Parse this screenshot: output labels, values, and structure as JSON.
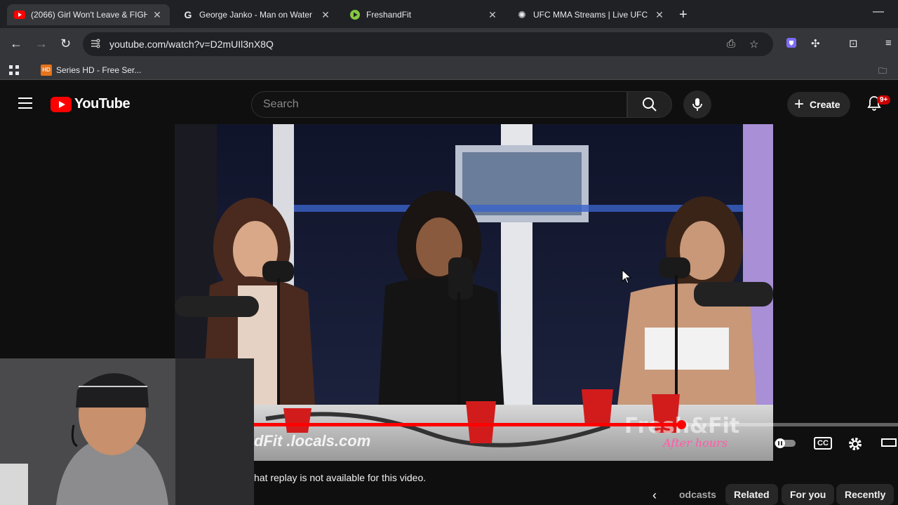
{
  "browser": {
    "tabs": [
      {
        "title": "(2066) Girl Won't Leave & FIGH",
        "icon": "youtube-icon",
        "active": true
      },
      {
        "title": "George Janko - Man on Water",
        "icon": "g-site-icon",
        "active": false
      },
      {
        "title": "FreshandFit",
        "icon": "rumble-icon",
        "active": false
      },
      {
        "title": "UFC MMA Streams | Live UFC C",
        "icon": "settings-site-icon",
        "active": false
      }
    ],
    "close_glyph": "✕",
    "new_tab_glyph": "+",
    "minimize_glyph": "—",
    "url": "youtube.com/watch?v=D2mUIl3nX8Q",
    "bookmarks": [
      {
        "label": "Series HD - Free Ser...",
        "icon": "series-hd-icon"
      }
    ],
    "bookmark_badge": "HD"
  },
  "youtube": {
    "logo_text": "YouTube",
    "search_placeholder": "Search",
    "create_label": "Create",
    "create_plus": "+",
    "notification_badge": "9+"
  },
  "video": {
    "watermark_text": "dFit .locals.com",
    "brand_overlay": "Fresh&Fit",
    "brand_overlay_sub": "After hours",
    "progress_fraction": 0.663,
    "cc_label": "CC"
  },
  "below_video": {
    "chat_message": "hat replay is not available for this video.",
    "chips": [
      "odcasts",
      "Related",
      "For you",
      "Recently"
    ]
  },
  "colors": {
    "youtube_red": "#ff0000",
    "page_bg": "#0f0f0f",
    "chrome_dark": "#202124",
    "chrome_toolbar": "#35363a"
  }
}
